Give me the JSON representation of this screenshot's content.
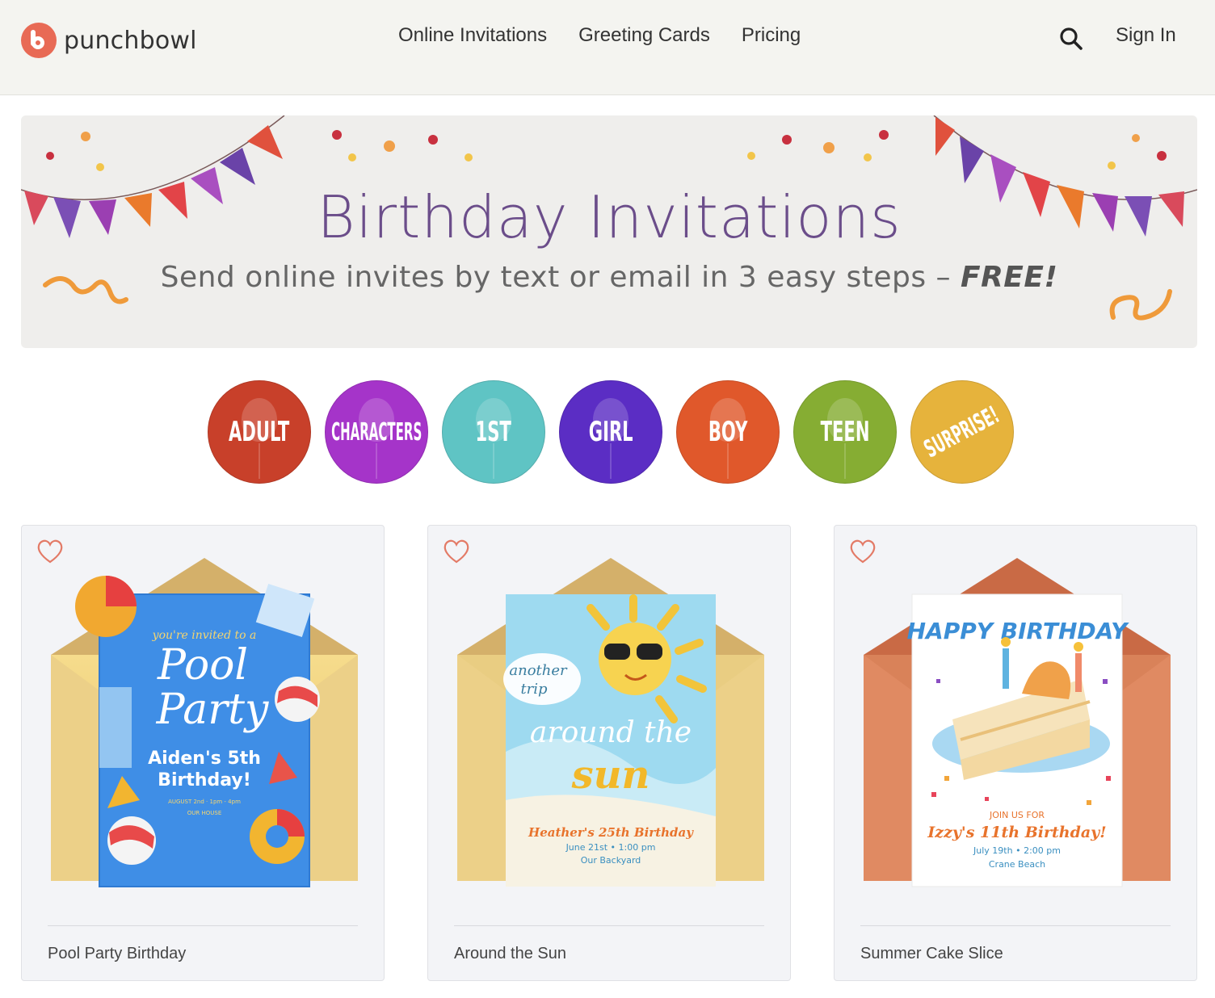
{
  "header": {
    "logo_text": "punchbowl",
    "nav": [
      "Online Invitations",
      "Greeting Cards",
      "Pricing"
    ],
    "search_icon": "search-icon",
    "signin_label": "Sign In"
  },
  "banner": {
    "title": "Birthday Invitations",
    "subtitle": "Send online invites by text or email in 3 easy steps – ",
    "subtitle_emphasis": "FREE!"
  },
  "categories": [
    {
      "label": "ADULT",
      "color": "#c8402a"
    },
    {
      "label": "CHARACTERS",
      "color": "#a534c9"
    },
    {
      "label": "1ST",
      "color": "#5fc4c4"
    },
    {
      "label": "GIRL",
      "color": "#5b2dc4"
    },
    {
      "label": "BOY",
      "color": "#e0582b"
    },
    {
      "label": "TEEN",
      "color": "#86ad33"
    },
    {
      "label": "SURPRISE!",
      "color": "#e6b33c"
    }
  ],
  "cards": [
    {
      "name": "Pool Party Birthday",
      "art": {
        "invited": "you're invited to a",
        "title1": "Pool",
        "title2": "Party",
        "line1": "Aiden's 5th",
        "line2": "Birthday!",
        "details": "AUGUST 2nd · 1pm - 4pm",
        "place": "OUR HOUSE"
      }
    },
    {
      "name": "Around the Sun",
      "art": {
        "t1": "another",
        "t2": "trip",
        "t3": "around the",
        "t4": "sun",
        "line1": "Heather's 25th Birthday",
        "line2": "June 21st • 1:00 pm",
        "line3": "Our Backyard"
      }
    },
    {
      "name": "Summer Cake Slice",
      "art": {
        "title": "HAPPY BIRTHDAY",
        "join": "JOIN US FOR",
        "line1": "Izzy's 11th Birthday!",
        "line2": "July 19th • 2:00 pm",
        "line3": "Crane Beach"
      }
    }
  ]
}
